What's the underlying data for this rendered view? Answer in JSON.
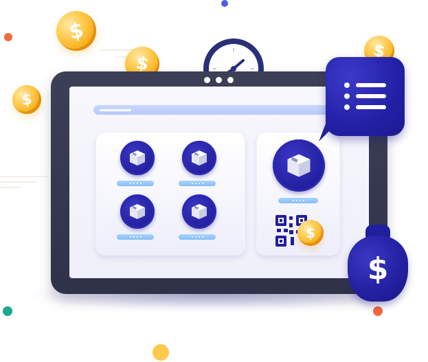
{
  "illustration": {
    "currency_symbol": "$",
    "colors": {
      "brand_navy": "#221f9e",
      "coin_gold": "#ffc94a",
      "device_frame": "#3d3f57",
      "screen_bg": "#f4f4fc",
      "accent_light_blue": "#a9d4ff",
      "accent_orange": "#f26a3d",
      "accent_teal": "#1aa88a"
    },
    "icons": [
      "coin-dollar-icon",
      "clock-icon",
      "product-box-icon",
      "qr-code-icon",
      "list-menu-icon",
      "money-bag-icon"
    ]
  }
}
